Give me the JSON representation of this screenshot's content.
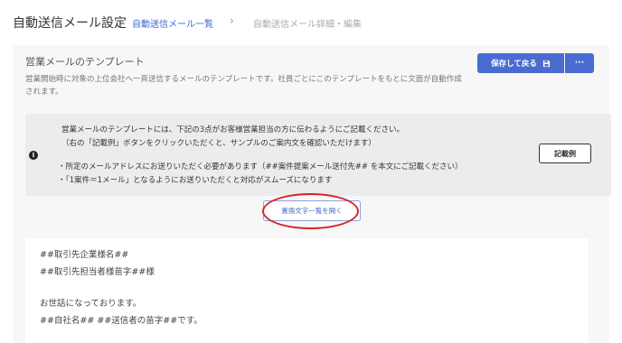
{
  "header": {
    "title": "自動送信メール設定",
    "breadcrumb_link": "自動送信メール一覧",
    "breadcrumb_sep": "›",
    "breadcrumb_current": "自動送信メール詳細・編集"
  },
  "template": {
    "title": "営業メールのテンプレート",
    "description": "営業開始時に対象の上位会社へ一斉送信するメールのテンプレートです。社員ごとにこのテンプレートをもとに文面が自動作成されます。",
    "save_label": "保存して戻る",
    "save_icon": "save-icon",
    "more_label": "···"
  },
  "notice": {
    "icon": "info-icon",
    "line1": "営業メールのテンプレートには、下記の3点がお客様営業担当の方に伝わるようにご記載ください。",
    "line2": "（右の「記載例」ボタンをクリックいただくと、サンプルのご案内文を確認いただけます）",
    "bullet1": "・所定のメールアドレスにお送りいただく必要があります（##案件提案メール送付先## を本文にご記載ください）",
    "bullet2": "・「1案件＝1メール」となるようにお送りいただくと対応がスムーズになります",
    "example_label": "記載例"
  },
  "open_vars_label": "置換文字一覧を開く",
  "editor": {
    "lines": [
      "##取引先企業様名##",
      "##取引先担当者様苗字##様",
      "",
      "お世話になっております。",
      "##自社名## ##送信者の苗字##です。"
    ]
  },
  "colors": {
    "accent": "#4a6bcf",
    "link": "#3e6ad6",
    "annotation": "#d8232a"
  }
}
